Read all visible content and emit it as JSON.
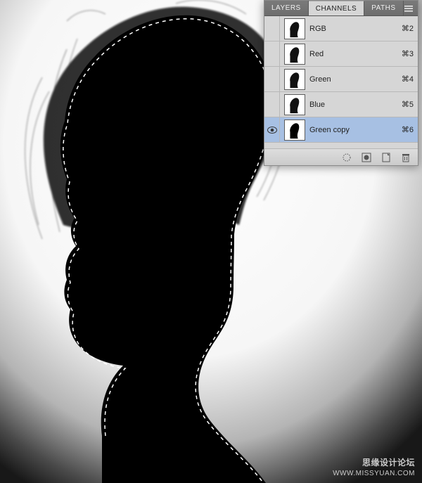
{
  "panel": {
    "tabs": {
      "layers": "LAYERS",
      "channels": "CHANNELS",
      "paths": "PATHS"
    },
    "channels": [
      {
        "name": "RGB",
        "shortcut": "⌘2",
        "visible": false,
        "selected": false,
        "thumb": "color"
      },
      {
        "name": "Red",
        "shortcut": "⌘3",
        "visible": false,
        "selected": false,
        "thumb": "color"
      },
      {
        "name": "Green",
        "shortcut": "⌘4",
        "visible": false,
        "selected": false,
        "thumb": "color"
      },
      {
        "name": "Blue",
        "shortcut": "⌘5",
        "visible": false,
        "selected": false,
        "thumb": "color"
      },
      {
        "name": "Green copy",
        "shortcut": "⌘6",
        "visible": true,
        "selected": true,
        "thumb": "bw"
      }
    ]
  },
  "watermark": {
    "line1": "思缘设计论坛",
    "line2": "WWW.MISSYUAN.COM"
  }
}
